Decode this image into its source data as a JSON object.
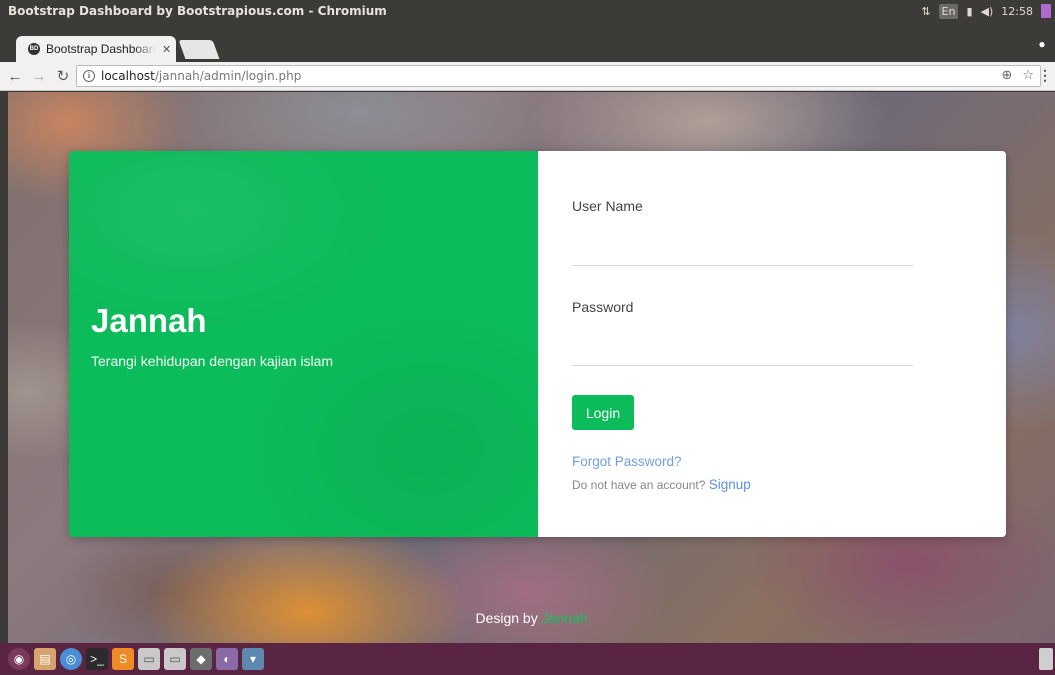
{
  "window": {
    "title": "Bootstrap Dashboard by Bootstrapious.com - Chromium",
    "clock": "12:58",
    "kb_layout": "En"
  },
  "browser": {
    "tab_title": "Bootstrap Dashboard by Bootstrapious.com",
    "tab_favicon_text": "BD",
    "url_host": "localhost",
    "url_path": "/jannah/admin/login.php"
  },
  "login_page": {
    "brand_title": "Jannah",
    "brand_tagline": "Terangi kehidupan dengan kajian islam",
    "username_label": "User Name",
    "username_value": "",
    "password_label": "Password",
    "password_value": "",
    "login_button": "Login",
    "forgot_password": "Forgot Password?",
    "signup_prompt": "Do not have an account?",
    "signup_link": "Signup",
    "footer_prefix": "Design by",
    "footer_brand": "Jannah"
  },
  "colors": {
    "accent": "#0cbb5a",
    "link": "#6f9fe3",
    "launcher_bg": "#5a2542"
  },
  "launcher": {
    "items": [
      "ubuntu-dash-icon",
      "files-icon",
      "chromium-icon",
      "terminal-icon",
      "sublime-text-icon",
      "drive-icon",
      "drive-icon",
      "inkscape-icon",
      "app-icon",
      "network-icon"
    ]
  }
}
